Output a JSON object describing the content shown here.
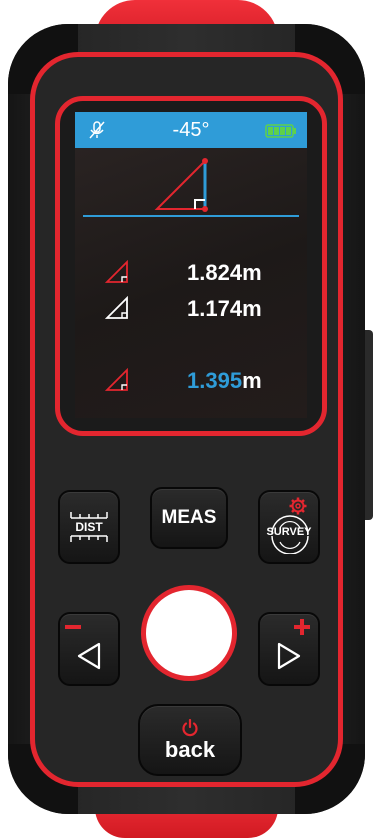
{
  "device": {
    "screen": {
      "angle": "-45°",
      "rows": [
        {
          "icon": "triangle-hypotenuse-icon",
          "value": "1.824",
          "unit": "m"
        },
        {
          "icon": "triangle-base-icon",
          "value": "1.174",
          "unit": "m"
        },
        {
          "icon": "triangle-height-icon",
          "value": "1.395",
          "unit": "m"
        }
      ]
    },
    "buttons": {
      "dist": "DIST",
      "meas": "MEAS",
      "survey": "SURVEY",
      "back": "back"
    },
    "colors": {
      "accent_red": "#e3262f",
      "accent_blue": "#2f9cd8",
      "battery_green": "#5fd14a"
    }
  }
}
